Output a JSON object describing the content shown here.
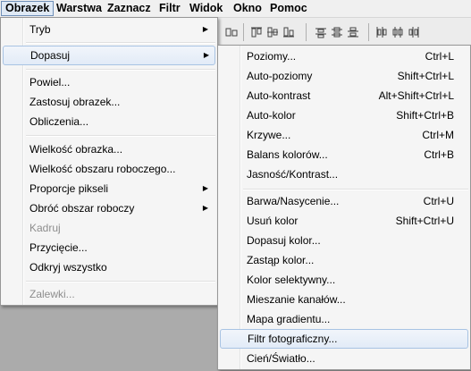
{
  "menubar": {
    "items": [
      "Obrazek",
      "Warstwa",
      "Zaznacz",
      "Filtr",
      "Widok",
      "Okno",
      "Pomoc"
    ]
  },
  "toolstrip": {
    "icons": [
      "align-icon",
      "align-top-icon",
      "align-vcenter-icon",
      "align-bottom-icon",
      "distribute-top-icon",
      "distribute-vcenter-icon",
      "distribute-bottom-icon",
      "distribute-left-icon",
      "distribute-hcenter-icon",
      "distribute-right-icon"
    ]
  },
  "obrazek_menu": {
    "items": [
      {
        "label": "Tryb",
        "submenu": true
      },
      {
        "label": "Dopasuj",
        "submenu": true,
        "highlighted": true
      },
      {
        "label": "Powiel..."
      },
      {
        "label": "Zastosuj obrazek..."
      },
      {
        "label": "Obliczenia..."
      },
      {
        "label": "Wielkość obrazka..."
      },
      {
        "label": "Wielkość obszaru roboczego..."
      },
      {
        "label": "Proporcje pikseli",
        "submenu": true
      },
      {
        "label": "Obróć obszar roboczy",
        "submenu": true
      },
      {
        "label": "Kadruj",
        "disabled": true
      },
      {
        "label": "Przycięcie..."
      },
      {
        "label": "Odkryj wszystko"
      },
      {
        "label": "Zalewki...",
        "disabled": true
      }
    ]
  },
  "dopasuj_menu": {
    "items": [
      {
        "label": "Poziomy...",
        "shortcut": "Ctrl+L"
      },
      {
        "label": "Auto-poziomy",
        "shortcut": "Shift+Ctrl+L"
      },
      {
        "label": "Auto-kontrast",
        "shortcut": "Alt+Shift+Ctrl+L"
      },
      {
        "label": "Auto-kolor",
        "shortcut": "Shift+Ctrl+B"
      },
      {
        "label": "Krzywe...",
        "shortcut": "Ctrl+M"
      },
      {
        "label": "Balans kolorów...",
        "shortcut": "Ctrl+B"
      },
      {
        "label": "Jasność/Kontrast...",
        "shortcut": ""
      },
      {
        "label": "Barwa/Nasycenie...",
        "shortcut": "Ctrl+U"
      },
      {
        "label": "Usuń kolor",
        "shortcut": "Shift+Ctrl+U"
      },
      {
        "label": "Dopasuj kolor...",
        "shortcut": ""
      },
      {
        "label": "Zastąp kolor...",
        "shortcut": ""
      },
      {
        "label": "Kolor selektywny...",
        "shortcut": ""
      },
      {
        "label": "Mieszanie kanałów...",
        "shortcut": ""
      },
      {
        "label": "Mapa gradientu...",
        "shortcut": ""
      },
      {
        "label": "Filtr fotograficzny...",
        "shortcut": "",
        "highlighted": true
      },
      {
        "label": "Cień/Światło...",
        "shortcut": ""
      }
    ]
  }
}
